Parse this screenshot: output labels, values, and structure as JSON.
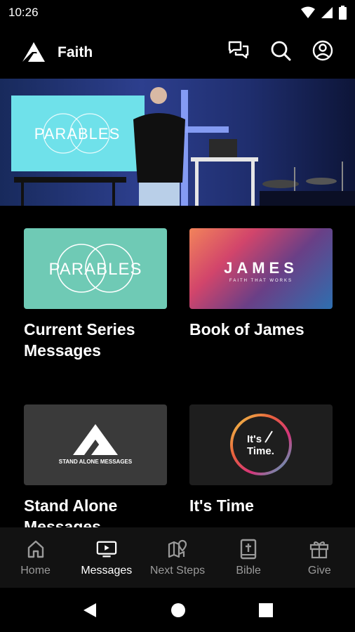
{
  "status_bar": {
    "time": "10:26"
  },
  "app_bar": {
    "title": "Faith"
  },
  "hero": {
    "screen_text": "PARABLES"
  },
  "cards": [
    {
      "title": "Current Series Messages",
      "thumb_text": "PARABLES",
      "thumb_color": "#6fcab5"
    },
    {
      "title": "Book of James",
      "thumb_text": "JAMES",
      "thumb_subtext": "FAITH THAT WORKS"
    },
    {
      "title": "Stand Alone Messages",
      "thumb_text": "STAND ALONE MESSAGES",
      "thumb_color": "#3a3a3a"
    },
    {
      "title": "It's Time",
      "thumb_text_1": "It's",
      "thumb_text_2": "Time.",
      "thumb_color": "#1e1e1e"
    }
  ],
  "bottom_nav": {
    "items": [
      {
        "label": "Home",
        "icon": "home-icon"
      },
      {
        "label": "Messages",
        "icon": "tv-play-icon",
        "active": true
      },
      {
        "label": "Next Steps",
        "icon": "map-pin-icon"
      },
      {
        "label": "Bible",
        "icon": "bible-icon"
      },
      {
        "label": "Give",
        "icon": "gift-icon"
      }
    ]
  },
  "colors": {
    "background": "#000000",
    "nav_background": "#121212",
    "inactive": "#9a9a9a"
  }
}
